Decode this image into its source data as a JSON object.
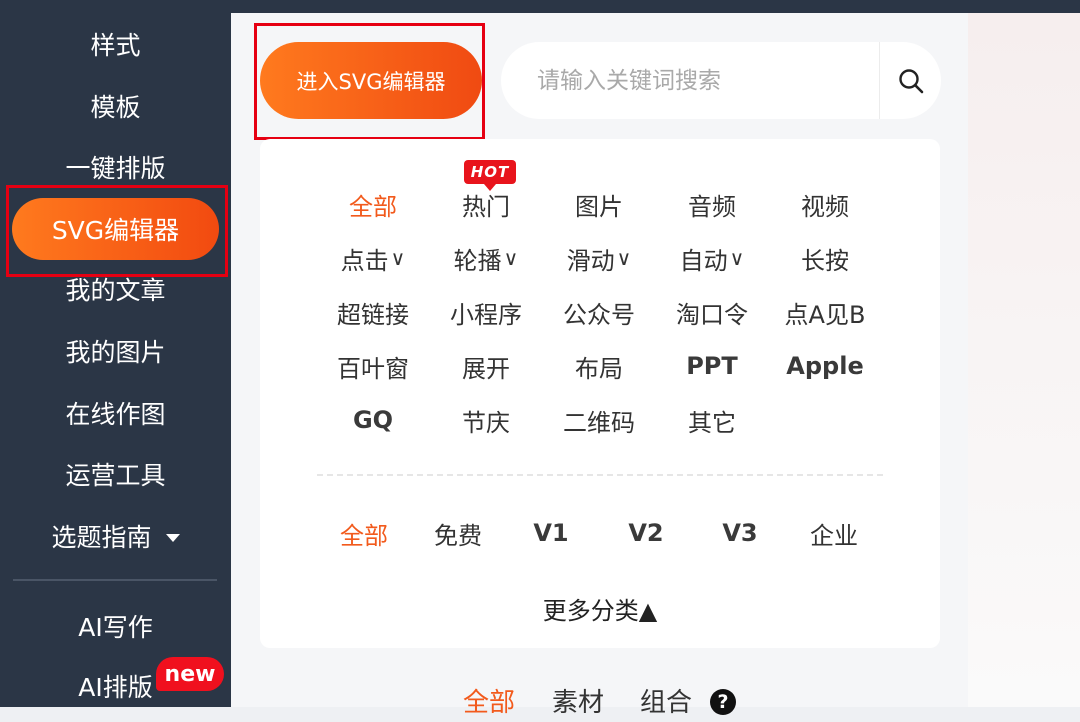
{
  "sidebar": {
    "items": [
      {
        "label": "样式"
      },
      {
        "label": "模板"
      },
      {
        "label": "一键排版"
      },
      {
        "label": "SVG编辑器"
      },
      {
        "label": "我的文章"
      },
      {
        "label": "我的图片"
      },
      {
        "label": "在线作图"
      },
      {
        "label": "运营工具"
      },
      {
        "label": "选题指南"
      },
      {
        "label": "AI写作"
      },
      {
        "label": "AI排版"
      }
    ],
    "new_badge": "new"
  },
  "toolbar": {
    "svg_button_label": "进入SVG编辑器",
    "search_placeholder": "请输入关键词搜索"
  },
  "categories": {
    "hot_badge": "HOT",
    "items": [
      "全部",
      "热门",
      "图片",
      "音频",
      "视频",
      "点击",
      "轮播",
      "滑动",
      "自动",
      "长按",
      "超链接",
      "小程序",
      "公众号",
      "淘口令",
      "点A见B",
      "百叶窗",
      "展开",
      "布局",
      "PPT",
      "Apple",
      "GQ",
      "节庆",
      "二维码",
      "其它"
    ],
    "dropdown_marker": "∨"
  },
  "tiers": {
    "items": [
      "全部",
      "免费",
      "V1",
      "V2",
      "V3",
      "企业"
    ]
  },
  "more_categories": "更多分类▲",
  "bottom_tabs": [
    "全部",
    "素材",
    "组合"
  ],
  "help_glyph": "?",
  "colors": {
    "sidebar_bg": "#2b3646",
    "accent_orange": "#f25a1c",
    "highlight_red": "#e60012"
  }
}
